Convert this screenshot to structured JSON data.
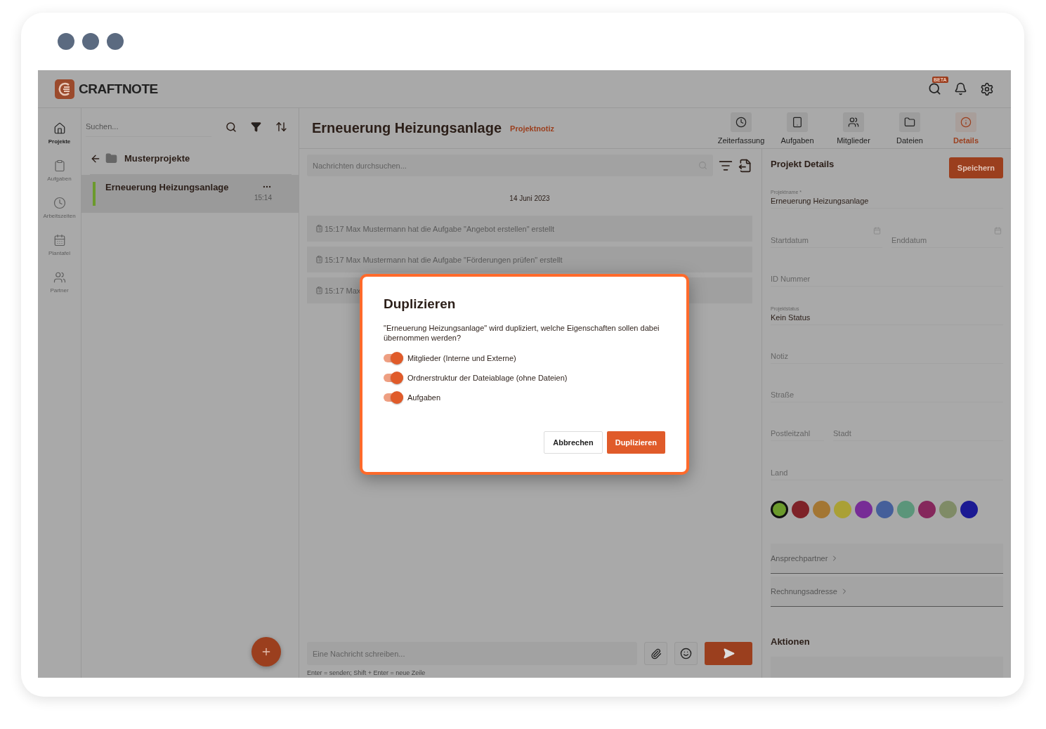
{
  "header": {
    "brand": "CRAFTNOTE",
    "badge": "BETA"
  },
  "rail": [
    {
      "label": "Projekte",
      "selected": true
    },
    {
      "label": "Aufgaben",
      "selected": false
    },
    {
      "label": "Arbeitszeiten",
      "selected": false
    },
    {
      "label": "Plantafel",
      "selected": false
    },
    {
      "label": "Partner",
      "selected": false
    }
  ],
  "project_list": {
    "search_placeholder": "Suchen...",
    "folder": "Musterprojekte",
    "projects": [
      {
        "name": "Erneuerung Heizungsanlage",
        "time": "15:14",
        "color": "#6b9a2c",
        "selected": true
      }
    ]
  },
  "project": {
    "title": "Erneuerung Heizungsanlage",
    "subtitle": "Projektnotiz"
  },
  "tabs": [
    {
      "label": "Zeiterfassung",
      "selected": false
    },
    {
      "label": "Aufgaben",
      "selected": false
    },
    {
      "label": "Mitglieder",
      "selected": false
    },
    {
      "label": "Dateien",
      "selected": false
    },
    {
      "label": "Details",
      "selected": true
    }
  ],
  "chat": {
    "search_placeholder": "Nachrichten durchsuchen...",
    "date": "14 Juni 2023",
    "messages": [
      {
        "text": "15:17 Max Mustermann hat die Aufgabe \"Angebot erstellen\" erstellt"
      },
      {
        "text": "15:17 Max Mustermann hat die Aufgabe \"Förderungen prüfen\" erstellt"
      },
      {
        "text": "15:17 Max"
      }
    ],
    "composer_placeholder": "Eine Nachricht schreiben...",
    "hint": "Enter = senden; Shift + Enter = neue Zeile"
  },
  "details": {
    "title": "Projekt Details",
    "save": "Speichern",
    "rows": [
      [
        {
          "label": "Projektname *",
          "value": "Erneuerung Heizungsanlage"
        }
      ],
      [
        {
          "label": "Startdatum",
          "kind": "date"
        },
        {
          "label": "Enddatum",
          "kind": "date"
        }
      ],
      [
        {
          "label": "ID Nummer"
        }
      ],
      [
        {
          "label": "Projektstatus",
          "value": "Kein Status"
        }
      ],
      [
        {
          "label": "Notiz"
        }
      ],
      [
        {
          "label": "Straße"
        }
      ],
      [
        {
          "label": "Postleitzahl",
          "kind": "short"
        },
        {
          "label": "Stadt"
        }
      ],
      [
        {
          "label": "Land"
        }
      ]
    ],
    "colors": [
      {
        "color": "#6b9a2c",
        "selected": true
      },
      {
        "color": "#7e2228",
        "selected": false
      },
      {
        "color": "#a37633",
        "selected": false
      },
      {
        "color": "#aaa035",
        "selected": false
      },
      {
        "color": "#772c96",
        "selected": false
      },
      {
        "color": "#455f9a",
        "selected": false
      },
      {
        "color": "#5b957a",
        "selected": false
      },
      {
        "color": "#85285c",
        "selected": false
      },
      {
        "color": "#7f8b66",
        "selected": false
      },
      {
        "color": "#1b1a93",
        "selected": false
      }
    ],
    "links": [
      "Ansprechpartner",
      "Rechnungsadresse"
    ],
    "actions_title": "Aktionen"
  },
  "dialog": {
    "title": "Duplizieren",
    "text": "\"Erneuerung Heizungsanlage\" wird dupliziert, welche Eigenschaften sollen dabei übernommen werden?",
    "options": [
      {
        "label": "Mitglieder (Interne und Externe)",
        "on": true
      },
      {
        "label": "Ordnerstruktur der Dateiablage (ohne Dateien)",
        "on": true
      },
      {
        "label": "Aufgaben",
        "on": true
      }
    ],
    "cancel": "Abbrechen",
    "confirm": "Duplizieren"
  }
}
